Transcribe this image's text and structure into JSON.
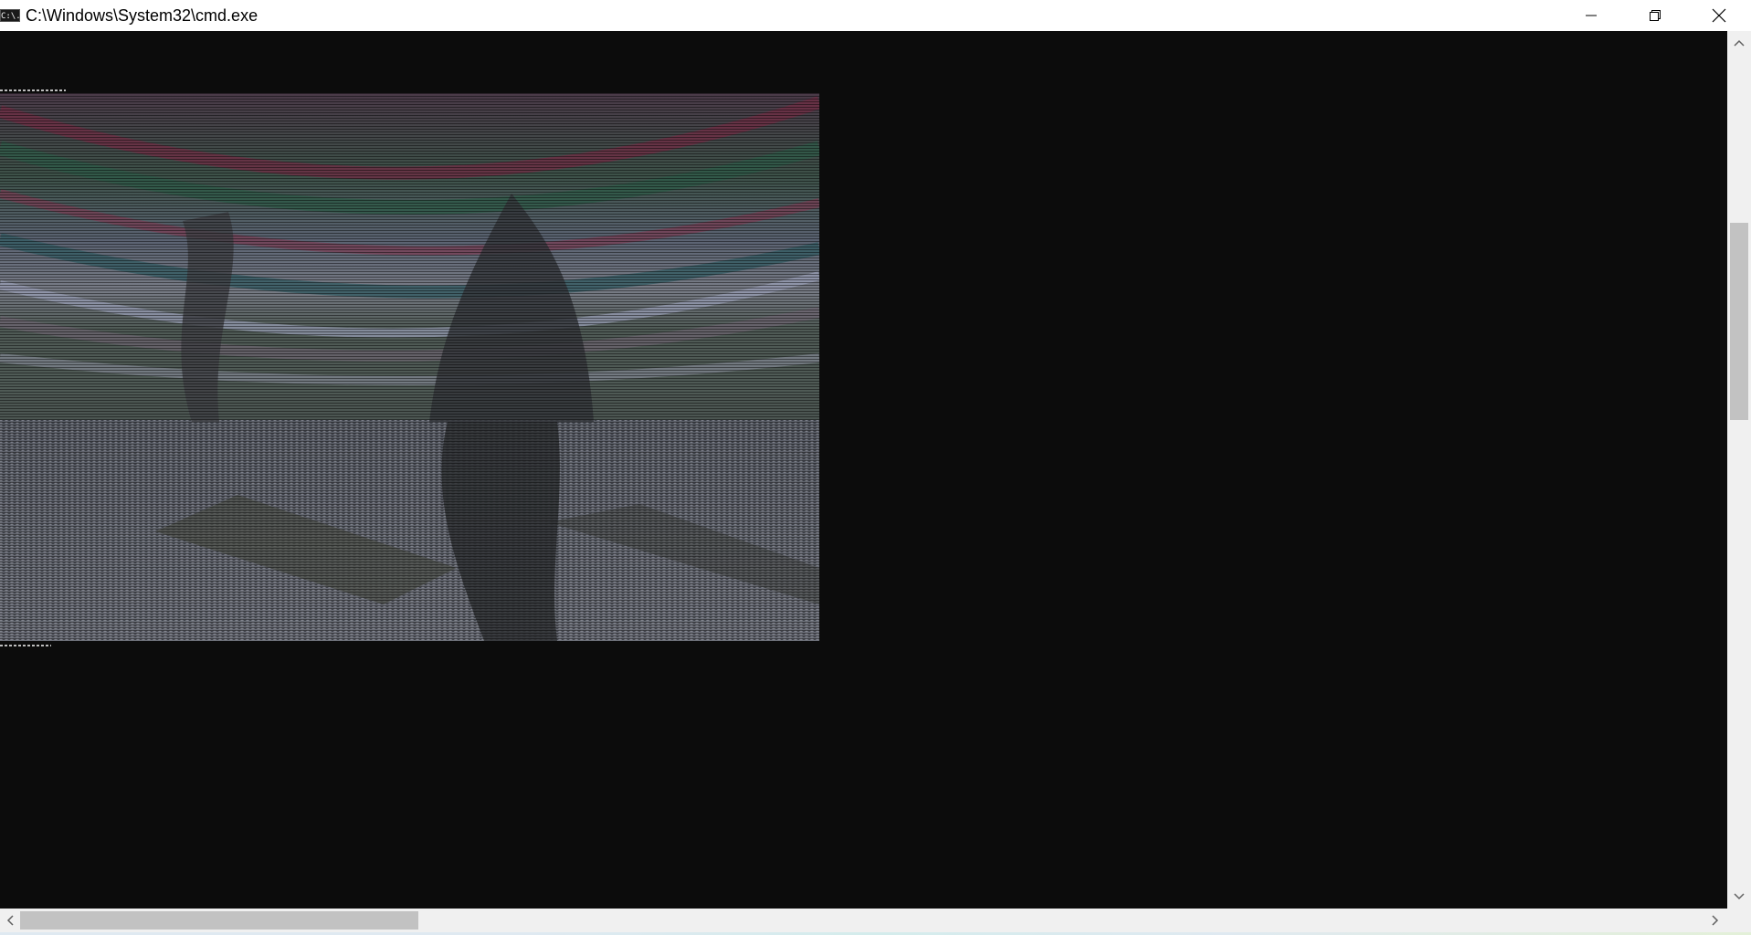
{
  "window": {
    "title": "C:\\Windows\\System32\\cmd.exe",
    "icon": "cmd-app-icon",
    "icon_label": "C:\\.",
    "controls": [
      "minimize-icon",
      "restore-icon",
      "close-icon"
    ]
  },
  "console": {
    "background_color": "#0c0c0c",
    "content": "ascii-color-art-image",
    "scene_palette": [
      "#5a2f3c",
      "#3f5a4e",
      "#6b7382",
      "#8b8e99",
      "#4e5d55",
      "#7a6f70"
    ]
  },
  "scrollbars": {
    "vertical": {
      "up_icon": "chevron-up-icon",
      "down_icon": "chevron-down-icon"
    },
    "horizontal": {
      "left_icon": "chevron-left-icon",
      "right_icon": "chevron-right-icon"
    }
  }
}
